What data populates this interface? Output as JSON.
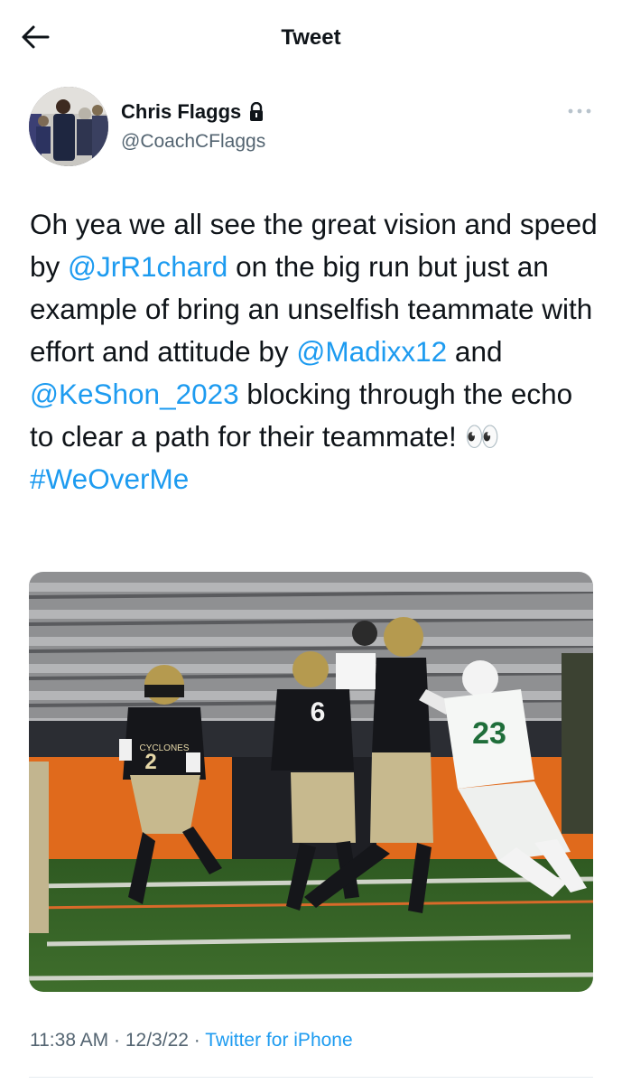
{
  "header": {
    "title": "Tweet",
    "back_icon": "back-arrow-icon"
  },
  "author": {
    "name": "Chris Flaggs",
    "handle": "@CoachCFlaggs",
    "protected_icon": "lock-icon"
  },
  "more_icon": "more-options-icon",
  "tweet": {
    "text_1": "Oh yea we all see the great vision and speed by ",
    "mention_1": "@JrR1chard",
    "text_2": " on the big run but just an example of bring an unselfish teammate with effort and attitude by ",
    "mention_2": "@Madixx12",
    "text_3": " and ",
    "mention_3": "@KeShon_2023",
    "text_4": " blocking through the echo to clear a path for their teammate! 👀 ",
    "hashtag": "#WeOverMe"
  },
  "media": {
    "jersey_numbers": [
      "2",
      "6",
      "23"
    ],
    "jersey_text": "CYCLONES"
  },
  "meta": {
    "time": "11:38 AM",
    "date": "12/3/22",
    "separator": "·",
    "source": "Twitter for iPhone"
  },
  "colors": {
    "link": "#1d9bf0",
    "secondary_text": "#536471",
    "primary_text": "#0f1419"
  }
}
